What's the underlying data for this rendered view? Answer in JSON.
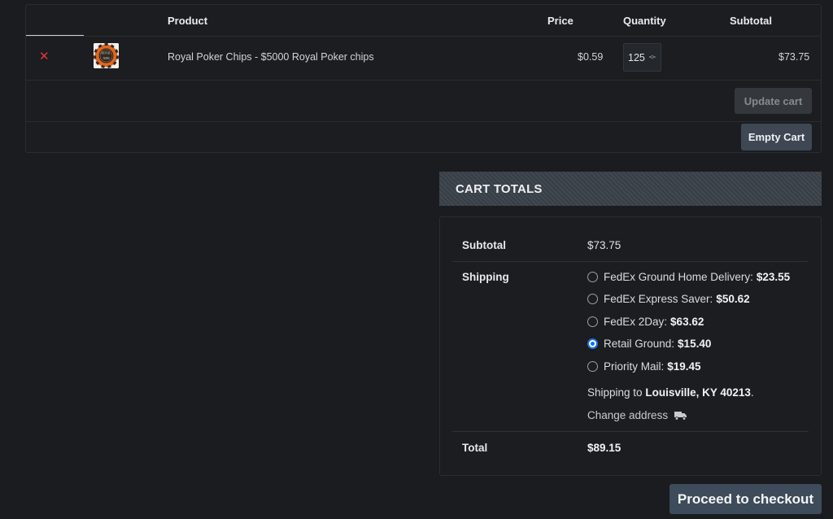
{
  "cart": {
    "headers": {
      "product": "Product",
      "price": "Price",
      "quantity": "Quantity",
      "subtotal": "Subtotal"
    },
    "items": [
      {
        "name": "Royal Poker Chips - $5000 Royal Poker chips",
        "price": "$0.59",
        "quantity": "125",
        "subtotal": "$73.75",
        "remove_icon": "close-icon",
        "thumb_text_top": "ROYAL",
        "thumb_text_bottom": "5000"
      }
    ],
    "update_cart_label": "Update cart",
    "empty_cart_label": "Empty Cart"
  },
  "totals": {
    "header": "CART TOTALS",
    "subtotal_label": "Subtotal",
    "subtotal_value": "$73.75",
    "shipping_label": "Shipping",
    "shipping_options": [
      {
        "label": "FedEx Ground Home Delivery:",
        "price": "$23.55",
        "selected": false
      },
      {
        "label": "FedEx Express Saver:",
        "price": "$50.62",
        "selected": false
      },
      {
        "label": "FedEx 2Day:",
        "price": "$63.62",
        "selected": false
      },
      {
        "label": "Retail Ground:",
        "price": "$15.40",
        "selected": true
      },
      {
        "label": "Priority Mail:",
        "price": "$19.45",
        "selected": false
      }
    ],
    "shipping_to_prefix": "Shipping to",
    "shipping_to_location": "Louisville, KY 40213",
    "shipping_to_suffix": ".",
    "change_address_label": "Change address",
    "change_address_icon": "truck-icon",
    "total_label": "Total",
    "total_value": "$89.15"
  },
  "checkout_label": "Proceed to checkout",
  "colors": {
    "background": "#1a1c1f",
    "remove": "#e5343c",
    "radio_selected": "#1a73e8",
    "checkout_button": "#3e4b5a"
  }
}
